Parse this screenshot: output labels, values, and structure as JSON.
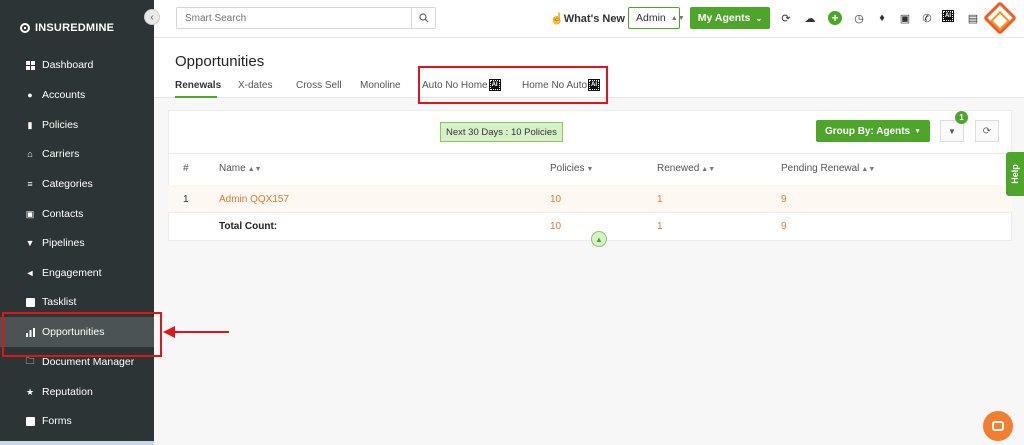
{
  "app": {
    "brand": "INSUREDMINE"
  },
  "sidebar": {
    "items": [
      {
        "label": "Dashboard",
        "icon": "dashboard-icon"
      },
      {
        "label": "Accounts",
        "icon": "accounts-icon"
      },
      {
        "label": "Policies",
        "icon": "policies-icon"
      },
      {
        "label": "Carriers",
        "icon": "carriers-icon"
      },
      {
        "label": "Categories",
        "icon": "categories-icon"
      },
      {
        "label": "Contacts",
        "icon": "contacts-icon"
      },
      {
        "label": "Pipelines",
        "icon": "pipelines-icon"
      },
      {
        "label": "Engagement",
        "icon": "engagement-icon"
      },
      {
        "label": "Tasklist",
        "icon": "tasklist-icon"
      },
      {
        "label": "Opportunities",
        "icon": "opportunities-icon",
        "active": true
      },
      {
        "label": "Document Manager",
        "icon": "document-manager-icon"
      },
      {
        "label": "Reputation",
        "icon": "reputation-icon"
      },
      {
        "label": "Forms",
        "icon": "forms-icon"
      }
    ]
  },
  "topbar": {
    "search_placeholder": "Smart Search",
    "whats_new": "What's New",
    "admin_select": "Admin",
    "my_agents_button": "My Agents"
  },
  "page": {
    "title": "Opportunities",
    "tabs": [
      {
        "label": "Renewals",
        "active": true
      },
      {
        "label": "X-dates"
      },
      {
        "label": "Cross Sell"
      },
      {
        "label": "Monoline"
      },
      {
        "label": "Auto No Home",
        "ai": true
      },
      {
        "label": "Home No Auto",
        "ai": true
      }
    ],
    "ai_badge": "AI"
  },
  "toolbar": {
    "next_days_badge": "Next 30 Days : 10 Policies",
    "group_by_button": "Group By: Agents",
    "filter_count": "1"
  },
  "table": {
    "columns": [
      "#",
      "Name",
      "Policies",
      "Renewed",
      "Pending Renewal"
    ],
    "rows": [
      {
        "index": "1",
        "name": "Admin QQX157",
        "policies": "10",
        "renewed": "1",
        "pending": "9"
      }
    ],
    "total": {
      "label": "Total Count:",
      "policies": "10",
      "renewed": "1",
      "pending": "9"
    }
  },
  "help_tab": "Help",
  "colors": {
    "sidebar": "#2c3436",
    "accent": "#4da52a",
    "highlight": "#e0141b",
    "link": "#e07b39"
  }
}
